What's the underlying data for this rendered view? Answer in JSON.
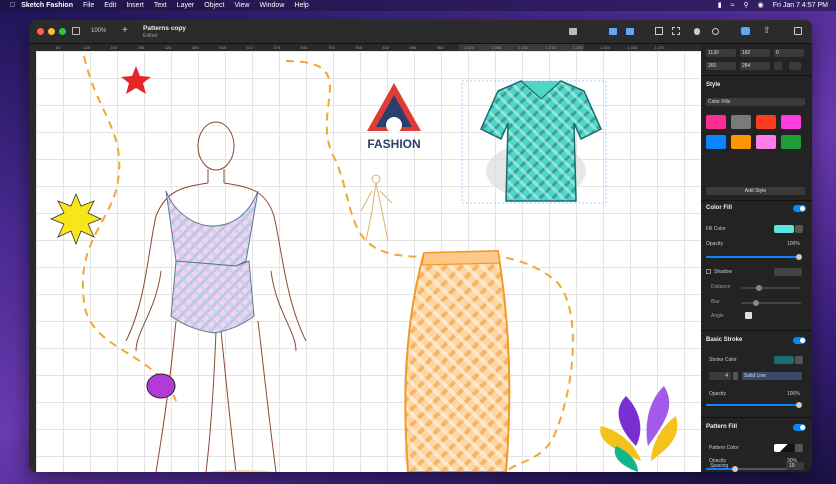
{
  "menubar": {
    "app": "Sketch Fashion",
    "items": [
      "File",
      "Edit",
      "Insert",
      "Text",
      "Layer",
      "Object",
      "View",
      "Window",
      "Help"
    ],
    "clock": "Fri Jan 7  4:57 PM"
  },
  "titlebar": {
    "zoom": "100%",
    "doc_title": "Patterns copy",
    "doc_subtitle": "Edited"
  },
  "ruler": {
    "ticks": [
      "64",
      "128",
      "192",
      "256",
      "320",
      "384",
      "448",
      "512",
      "576",
      "640",
      "704",
      "768",
      "832",
      "896",
      "960",
      "1,024",
      "1,088",
      "1,152",
      "1,216",
      "1,280",
      "1,344",
      "1,408",
      "1,472"
    ]
  },
  "canvas": {
    "logo_text": "FASHION"
  },
  "inspector": {
    "x": "1130",
    "y": "182",
    "w": "260",
    "h": "284",
    "rotation": "0",
    "style_title": "Style",
    "fills_select": "Color Fills",
    "swatches": [
      "#ff2d92",
      "#7a7a7a",
      "#ff3b1f",
      "#ff3ddf",
      "#0a84ff",
      "#ff9500",
      "#ff7de9",
      "#1f9e37"
    ],
    "add_style": "Add Style",
    "color_fill": {
      "title": "Color Fill",
      "fill_label": "Fill Color",
      "fill_color": "#5ee3e0",
      "opacity_label": "Opacity",
      "opacity_value": "100%",
      "opacity": 1.0
    },
    "shadow": {
      "label": "Shadow",
      "distance": "Distance",
      "blur": "Blur",
      "angle": "Angle"
    },
    "stroke": {
      "title": "Basic Stroke",
      "color_label": "Stroke Color",
      "stroke_color": "#1c6a74",
      "width": "4",
      "style": "Solid Line",
      "opacity_label": "Opacity",
      "opacity_value": "100%",
      "opacity": 1.0
    },
    "pattern": {
      "title": "Pattern Fill",
      "color_label": "Pattern Color",
      "opacity_label": "Opacity",
      "opacity_value": "30%",
      "opacity": 0.3,
      "spacing_label": "Spacing",
      "spacing_value": "19"
    }
  }
}
